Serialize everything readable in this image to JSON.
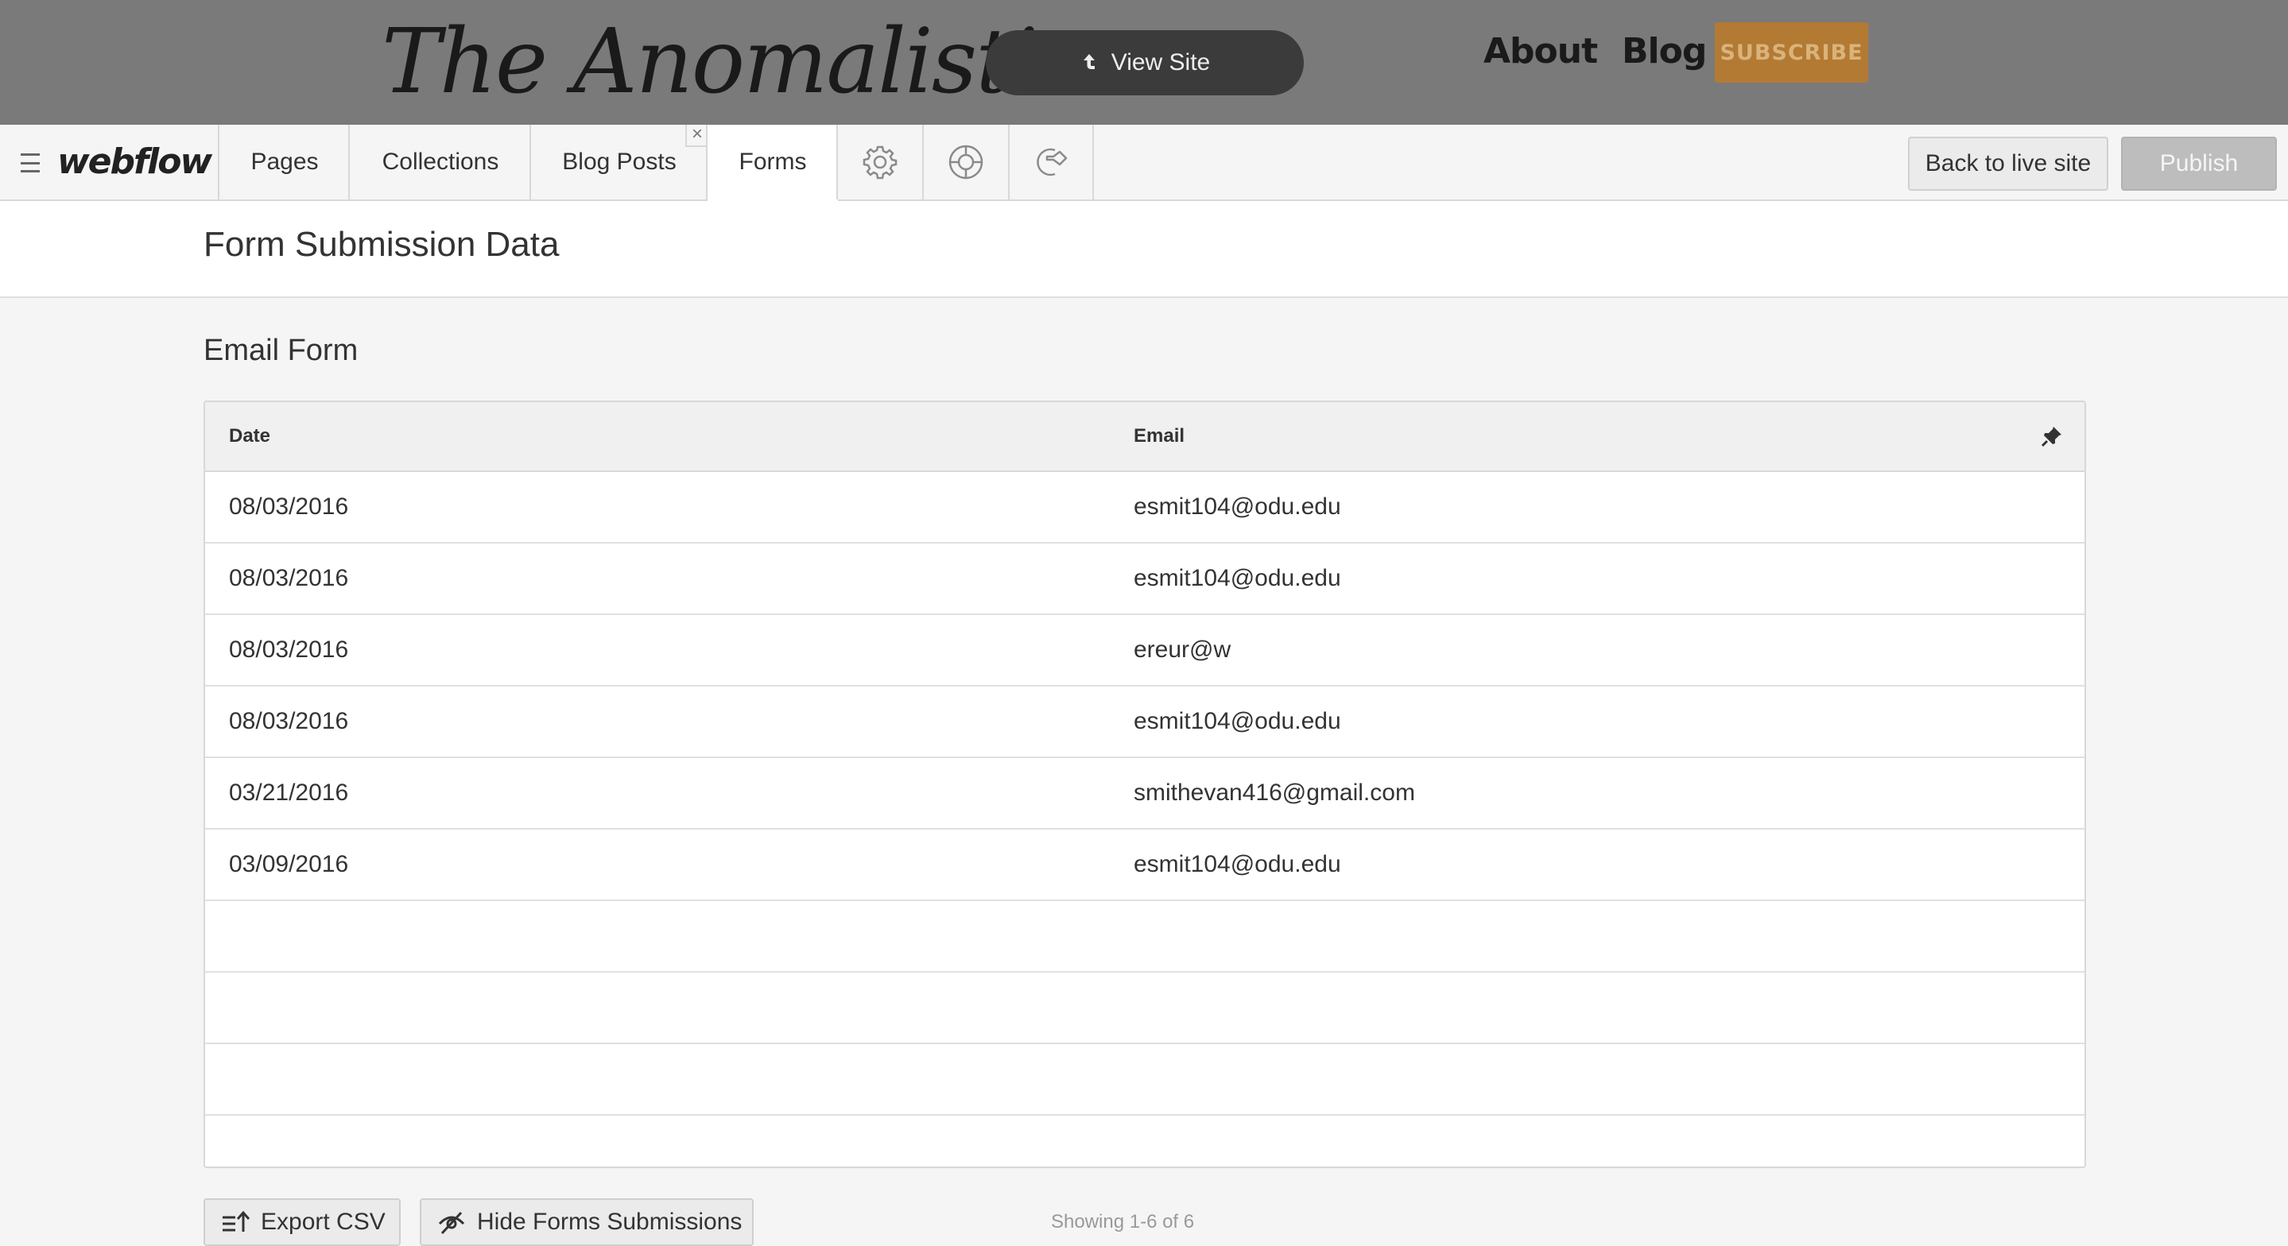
{
  "site": {
    "logo": "The Anomalistic",
    "view_site": "View Site",
    "nav": [
      "About",
      "Blog"
    ],
    "subscribe": "SUBSCRIBE"
  },
  "toolbar": {
    "logo": "webflow",
    "tabs": [
      "Pages",
      "Collections",
      "Blog Posts",
      "Forms"
    ],
    "active_tab": "Forms",
    "close_glyph": "×",
    "icons": [
      "gear-icon",
      "help-lifebuoy-icon",
      "logout-icon"
    ],
    "back_to_live": "Back to live site",
    "publish": "Publish"
  },
  "page": {
    "title": "Form Submission Data"
  },
  "form": {
    "name": "Email Form",
    "columns": [
      "Date",
      "Email"
    ],
    "rows": [
      {
        "date": "08/03/2016",
        "email": "esmit104@odu.edu"
      },
      {
        "date": "08/03/2016",
        "email": "esmit104@odu.edu"
      },
      {
        "date": "08/03/2016",
        "email": "ereur@w"
      },
      {
        "date": "08/03/2016",
        "email": "esmit104@odu.edu"
      },
      {
        "date": "03/21/2016",
        "email": "smithevan416@gmail.com"
      },
      {
        "date": "03/09/2016",
        "email": "esmit104@odu.edu"
      }
    ],
    "empty_rows": 4
  },
  "footer": {
    "export_csv": "Export CSV",
    "hide_submissions": "Hide Forms Submissions",
    "showing": "Showing 1-6 of 6"
  },
  "colors": {
    "site_bar": "#7a7a7a",
    "subscribe_bg": "#b37a33",
    "publish_bg": "#bdbdbd",
    "view_site_bg": "#3b3b3b"
  }
}
